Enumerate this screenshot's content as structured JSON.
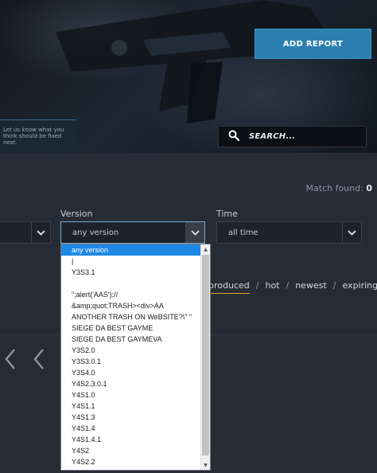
{
  "hero": {
    "note": "Let us know what you think should be fixed next.",
    "add_report_label": "ADD REPORT",
    "search_placeholder": "SEARCH..."
  },
  "results": {
    "match_label": "Match found:",
    "match_count": "0"
  },
  "filters": {
    "version": {
      "label": "Version",
      "value": "any version"
    },
    "time": {
      "label": "Time",
      "value": "all time"
    }
  },
  "sort": {
    "items": [
      "produced",
      "hot",
      "newest",
      "expiring"
    ],
    "active": "produced"
  },
  "version_options": [
    "any version",
    "|",
    "Y3S3.1",
    "",
    "\";alert('AAS');//",
    "&amp;quot;TRASH><div>AA",
    "ANOTHER TRASH ON WeBSITE?\\\" \"",
    "SIEGE DA BEST GAYME",
    "SIEGE DA BEST GAYMEVA",
    "Y3S2.0",
    "Y3S3.0.1",
    "Y3S4.0",
    "Y4S2.3.0.1",
    "Y4S1.0",
    "Y4S1.1",
    "Y4S1.3",
    "Y4S1.4",
    "Y4S1.4.1",
    "Y4S2",
    "Y4S2.2"
  ],
  "colors": {
    "accent": "#2b7fb0",
    "selected_option": "#1e88e5",
    "sort_underline": "#d9a630",
    "background": "#262b34"
  },
  "icons": {
    "search": "search-icon",
    "caret": "chevron-down-icon",
    "pagination": "chevron-left-icon"
  }
}
